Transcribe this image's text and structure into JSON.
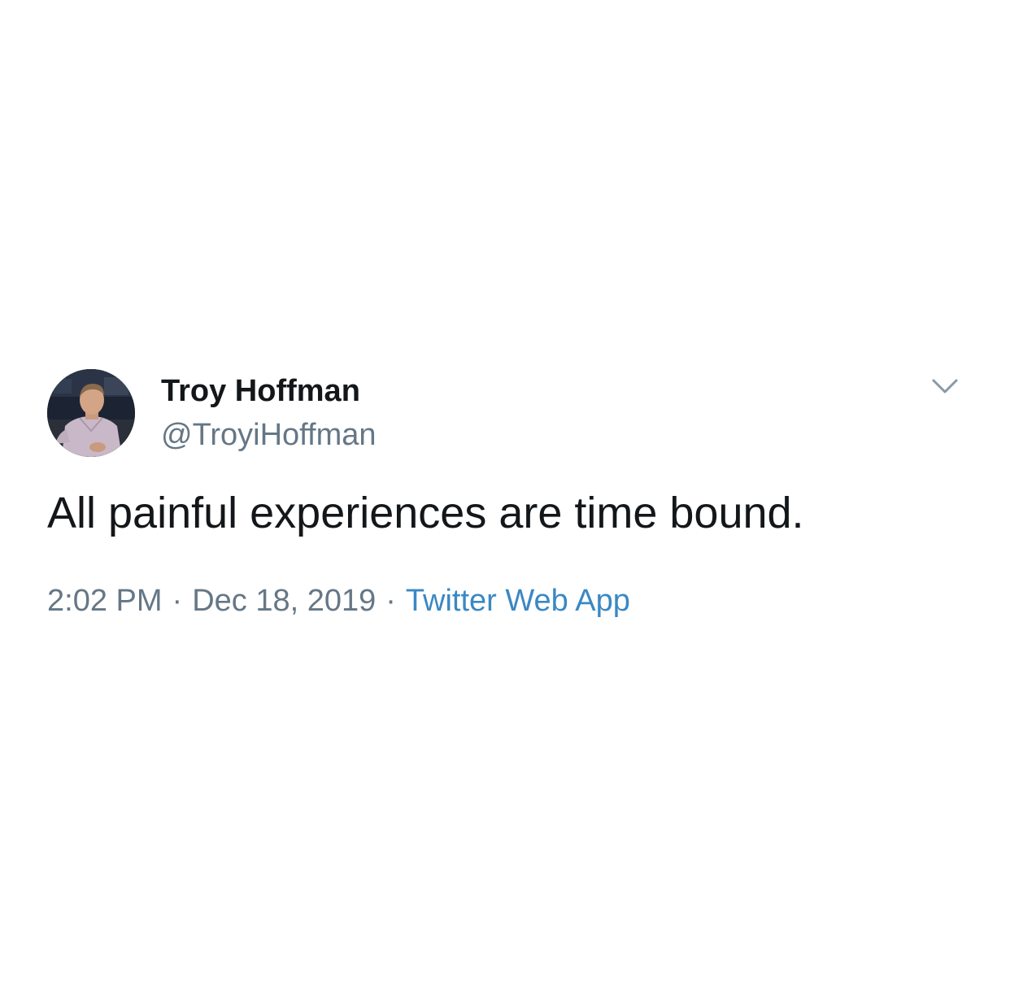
{
  "tweet": {
    "author": {
      "display_name": "Troy Hoffman",
      "handle": "@TroyiHoffman",
      "avatar_icon": "profile-photo"
    },
    "text": "All painful experiences are time bound.",
    "meta": {
      "time": "2:02 PM",
      "separator": "·",
      "date": "Dec 18, 2019",
      "source": "Twitter Web App"
    },
    "menu_icon": "chevron-down-icon"
  },
  "colors": {
    "text_primary": "#14171a",
    "text_secondary": "#657786",
    "link": "#3b88c3",
    "background": "#ffffff"
  }
}
